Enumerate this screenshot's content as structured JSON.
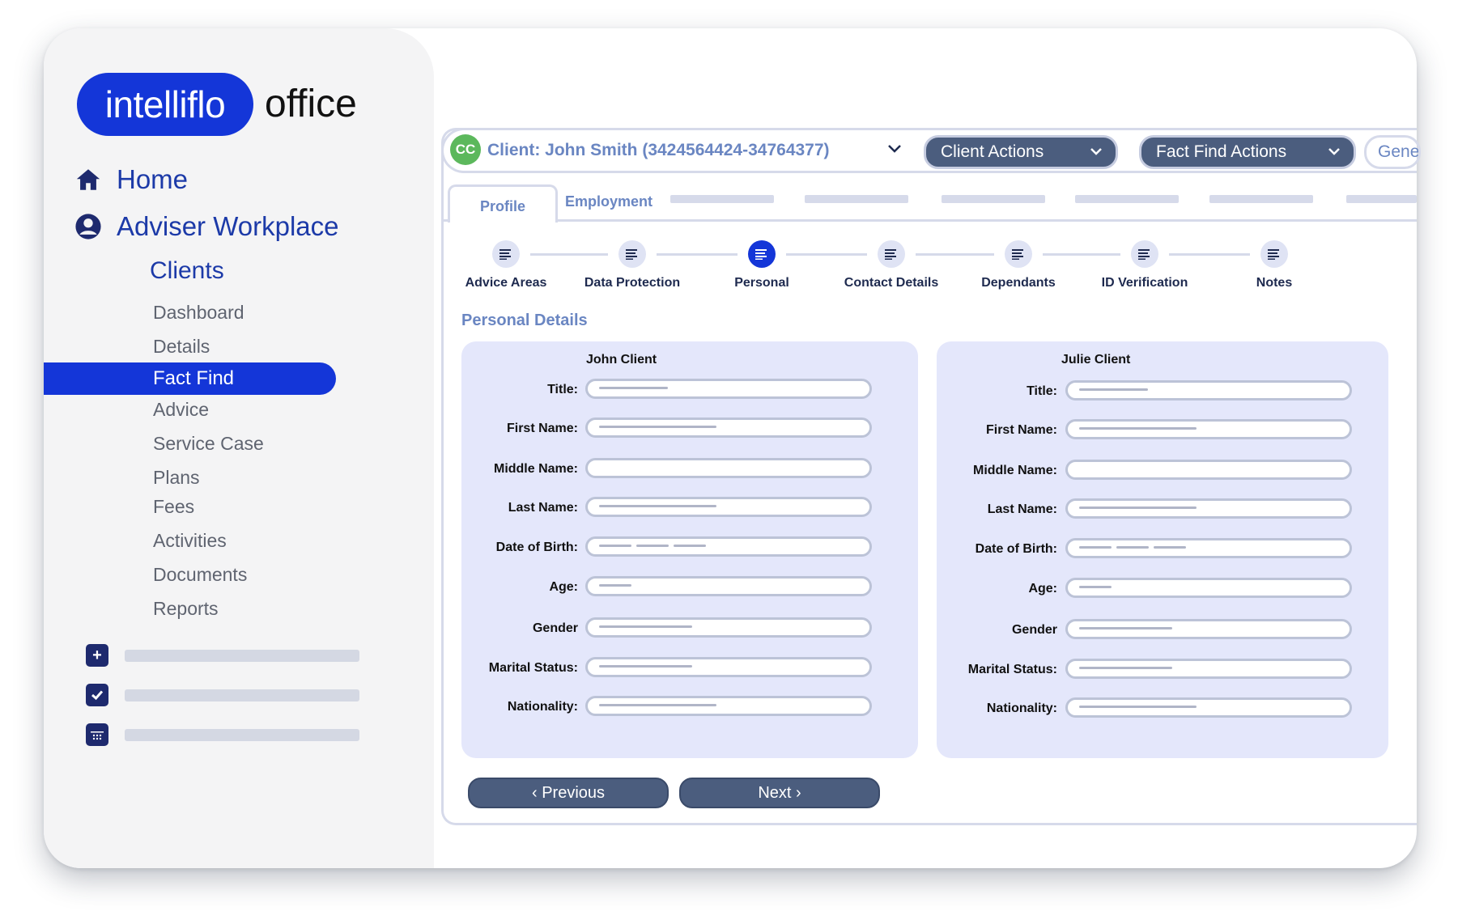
{
  "brand": {
    "logo_word": "intelliflo",
    "logo_suffix": "office"
  },
  "sidebar": {
    "home": "Home",
    "workplace": "Adviser Workplace",
    "clients": "Clients",
    "items": [
      "Dashboard",
      "Details",
      "Fact Find",
      "Advice",
      "Service Case",
      "Plans",
      "Fees",
      "Activities",
      "Documents",
      "Reports"
    ],
    "active_item": "Fact Find",
    "tools": [
      "plus-square-icon",
      "check-square-icon",
      "calendar-icon"
    ]
  },
  "client_bar": {
    "initials": "CC",
    "client_label": "Client: John Smith (3424564424-34764377)",
    "client_actions": "Client Actions",
    "fact_find_actions": "Fact Find Actions",
    "more": "Gene"
  },
  "tabs": {
    "profile": "Profile",
    "employment": "Employment"
  },
  "steps": [
    "Advice Areas",
    "Data Protection",
    "Personal",
    "Contact Details",
    "Dependants",
    "ID Verification",
    "Notes"
  ],
  "active_step": "Personal",
  "section_title": "Personal Details",
  "clients": [
    {
      "name": "John Client"
    },
    {
      "name": "Julie Client"
    }
  ],
  "field_labels": [
    "Title:",
    "First Name:",
    "Middle Name:",
    "Last Name:",
    "Date of Birth:",
    "Age:",
    "Gender",
    "Marital Status:",
    "Nationality:"
  ],
  "buttons": {
    "previous": "Previous",
    "next": "Next"
  },
  "colors": {
    "brand_blue": "#1436d8",
    "nav_text": "#1c3aa8",
    "panel_bg": "#e4e7fb",
    "button_bg": "#4b5d7e",
    "avatar_green": "#5cb85c"
  }
}
